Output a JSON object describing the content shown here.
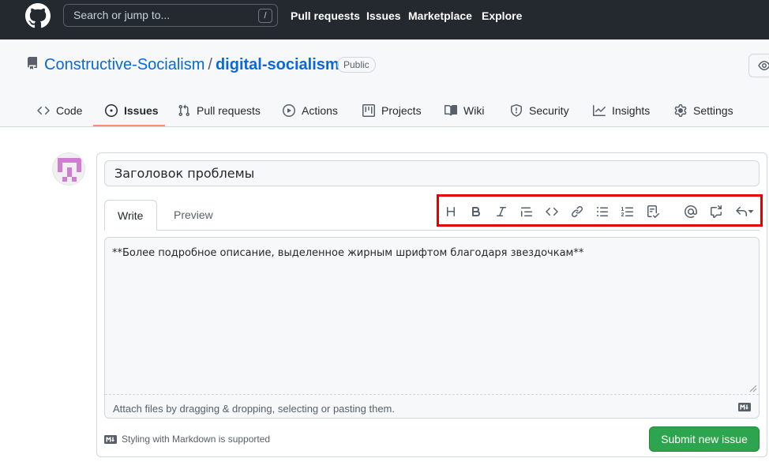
{
  "header": {
    "search_placeholder": "Search or jump to...",
    "search_shortcut": "/",
    "nav": [
      "Pull requests",
      "Issues",
      "Marketplace",
      "Explore"
    ]
  },
  "repo": {
    "owner": "Constructive-Socialism",
    "separator": "/",
    "name": "digital-socialism",
    "visibility": "Public"
  },
  "tabs": [
    {
      "label": "Code",
      "icon": "code-icon"
    },
    {
      "label": "Issues",
      "icon": "issue-icon",
      "selected": true
    },
    {
      "label": "Pull requests",
      "icon": "pull-request-icon"
    },
    {
      "label": "Actions",
      "icon": "play-icon"
    },
    {
      "label": "Projects",
      "icon": "project-icon"
    },
    {
      "label": "Wiki",
      "icon": "book-icon"
    },
    {
      "label": "Security",
      "icon": "shield-icon"
    },
    {
      "label": "Insights",
      "icon": "graph-icon"
    },
    {
      "label": "Settings",
      "icon": "gear-icon"
    }
  ],
  "issue_form": {
    "title_value": "Заголовок проблемы",
    "tab_write": "Write",
    "tab_preview": "Preview",
    "body_value": "**Более подробное описание, выделенное жирным шрифтом благодаря звездочкам**",
    "attach_hint": "Attach files by dragging & dropping, selecting or pasting them.",
    "markdown_note": "Styling with Markdown is supported",
    "submit_label": "Submit new issue"
  },
  "toolbar": [
    "heading-icon",
    "bold-icon",
    "italic-icon",
    "quote-icon",
    "code-icon",
    "link-icon",
    "unordered-list-icon",
    "ordered-list-icon",
    "tasklist-icon",
    "mention-icon",
    "cross-reference-icon",
    "reply-icon"
  ],
  "colors": {
    "header_bg": "#24292f",
    "link": "#0969da",
    "submit_green": "#2da44e",
    "highlight_red": "#e00000",
    "tab_underline": "#fd8c73"
  }
}
